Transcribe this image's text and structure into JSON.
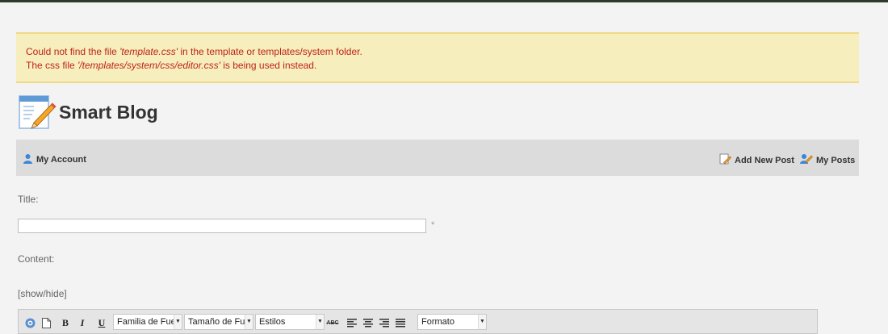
{
  "notice": {
    "line1_prefix": "Could not find the file ",
    "line1_file": "'template.css'",
    "line1_suffix": " in the template or templates/system folder.",
    "line2_prefix": "The css file ",
    "line2_file": "'/templates/system/css/editor.css'",
    "line2_suffix": " is being used instead."
  },
  "brand": {
    "title": "Smart Blog",
    "icon": "notepad-pencil-icon"
  },
  "nav": {
    "my_account": "My Account",
    "add_new_post": "Add New Post",
    "my_posts": "My Posts"
  },
  "form": {
    "title_label": "Title:",
    "title_value": "",
    "required_mark": "*",
    "content_label": "Content:",
    "show_hide": "[show/hide]"
  },
  "toolbar": {
    "bold": "B",
    "italic": "I",
    "underline": "U",
    "font_family": "Familia de Fuente",
    "font_size": "Tamaño de Fuente",
    "styles": "Estilos",
    "format": "Formato",
    "spellcheck": "ABC"
  },
  "colors": {
    "notice_bg": "#f6eebc",
    "notice_text": "#c0221a",
    "navbar_bg": "#dcdcdc"
  }
}
